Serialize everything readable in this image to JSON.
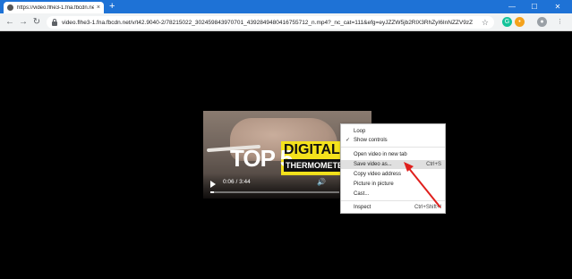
{
  "tab": {
    "title": "https://video.flhe3-1.fna.fbcdn.net/",
    "close": "×"
  },
  "newtab": "+",
  "window_controls": {
    "minimize": "—",
    "maximize": "☐",
    "close": "✕"
  },
  "nav": {
    "back": "←",
    "forward": "→",
    "reload": "↻"
  },
  "address": {
    "url": "video.flhe3-1.fna.fbcdn.net/v/t42.9040-2/78215022_302459843970701_4392849480416755712_n.mp4?_nc_cat=111&efg=eyJZZW5jb2RlX3RhZyI6InNZZV9zZ"
  },
  "extensions": [
    {
      "name": "grammarly-icon",
      "color": "#15c39a",
      "glyph": "G"
    },
    {
      "name": "orange-extension-icon",
      "color": "#f4a21c",
      "glyph": "•"
    },
    {
      "name": "profile-icon",
      "color": "#9aa0a6",
      "glyph": "●"
    },
    {
      "name": "menu-icon",
      "color": "#5f6368",
      "glyph": "⋮"
    }
  ],
  "video": {
    "title_big": "TOP 5",
    "title_yellow": "DIGITAL",
    "title_black": "THERMOMETERS",
    "timecode": "0:06 / 3:44",
    "progress_fraction": 0.027
  },
  "context_menu": {
    "items": [
      {
        "label": "Loop",
        "checked": false,
        "shortcut": ""
      },
      {
        "label": "Show controls",
        "checked": true,
        "shortcut": ""
      },
      {
        "label": "Open video in new tab",
        "checked": false,
        "shortcut": ""
      },
      {
        "label": "Save video as...",
        "checked": false,
        "shortcut": "Ctrl+S",
        "highlighted": true
      },
      {
        "label": "Copy video address",
        "checked": false,
        "shortcut": ""
      },
      {
        "label": "Picture in picture",
        "checked": false,
        "shortcut": ""
      },
      {
        "label": "Cast...",
        "checked": false,
        "shortcut": ""
      },
      {
        "label": "Inspect",
        "checked": false,
        "shortcut": "Ctrl+Shift+I"
      }
    ],
    "check_glyph": "✓"
  },
  "colors": {
    "chrome_blue": "#1e72d6",
    "arrow_red": "#e0201d",
    "video_yellow": "#f4e21c"
  }
}
